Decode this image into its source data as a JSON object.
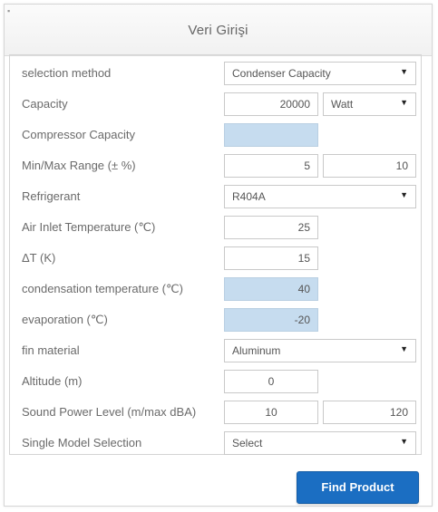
{
  "header": {
    "title": "Veri Girişi"
  },
  "rows": {
    "selection_method": {
      "label": "selection method",
      "value": "Condenser Capacity"
    },
    "capacity": {
      "label": "Capacity",
      "value": "20000",
      "unit": "Watt"
    },
    "compressor_capacity": {
      "label": "Compressor Capacity",
      "value": ""
    },
    "minmax_range": {
      "label": "Min/Max Range (± %)",
      "min": "5",
      "max": "10"
    },
    "refrigerant": {
      "label": "Refrigerant",
      "value": "R404A"
    },
    "air_inlet_temp": {
      "label": "Air Inlet Temperature (℃)",
      "value": "25"
    },
    "delta_t": {
      "label": "ΔT (K)",
      "value": "15"
    },
    "condensation_temp": {
      "label": "condensation temperature (℃)",
      "value": "40"
    },
    "evaporation": {
      "label": "evaporation (℃)",
      "value": "-20"
    },
    "fin_material": {
      "label": "fin material",
      "value": "Aluminum"
    },
    "altitude": {
      "label": "Altitude (m)",
      "value": "0"
    },
    "sound_power": {
      "label": "Sound Power Level (m/max dBA)",
      "min": "10",
      "max": "120"
    },
    "single_model": {
      "label": "Single Model Selection",
      "value": "Select"
    }
  },
  "actions": {
    "find_product": "Find Product"
  },
  "icons": {
    "dropdown": "chevron-down-icon",
    "dropdown_glyph": "▼"
  },
  "colors": {
    "readonly_field": "#c6dcef",
    "primary_button": "#1b6ec2"
  }
}
